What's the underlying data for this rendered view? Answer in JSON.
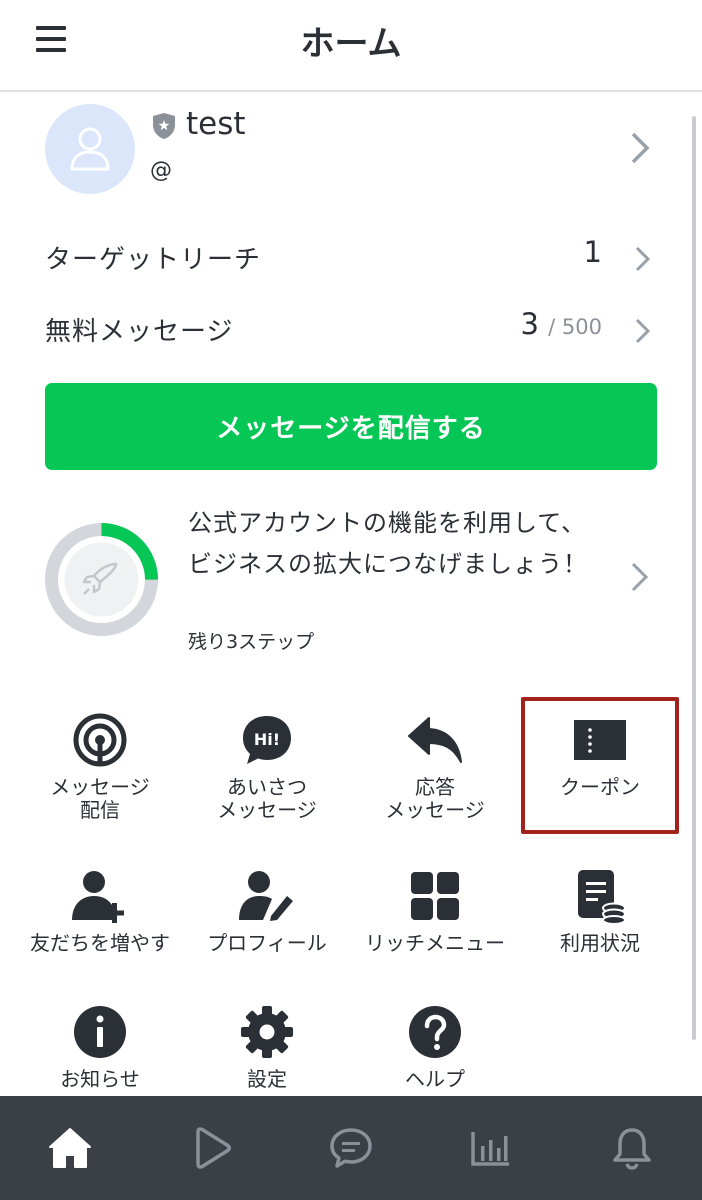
{
  "header": {
    "title": "ホーム"
  },
  "profile": {
    "name": "test",
    "id_prefix": "@"
  },
  "stats": {
    "target_reach": {
      "label": "ターゲットリーチ",
      "value": "1"
    },
    "free_messages": {
      "label": "無料メッセージ",
      "value": "3",
      "limit": "/ 500"
    }
  },
  "primary_action": {
    "label": "メッセージを配信する"
  },
  "onboarding": {
    "text": "公式アカウントの機能を利用して、ビジネスの拡大につなげましょう！",
    "steps": "残り3ステップ",
    "progress": 0.25
  },
  "features": [
    {
      "label": "メッセージ\n配信",
      "icon": "broadcast-icon"
    },
    {
      "label": "あいさつ\nメッセージ",
      "icon": "greeting-icon"
    },
    {
      "label": "応答\nメッセージ",
      "icon": "reply-icon"
    },
    {
      "label": "クーポン",
      "icon": "coupon-icon"
    },
    {
      "label": "友だちを増やす",
      "icon": "add-friend-icon"
    },
    {
      "label": "プロフィール",
      "icon": "profile-edit-icon"
    },
    {
      "label": "リッチメニュー",
      "icon": "rich-menu-icon"
    },
    {
      "label": "利用状況",
      "icon": "usage-icon"
    },
    {
      "label": "お知らせ",
      "icon": "info-icon"
    },
    {
      "label": "設定",
      "icon": "settings-icon"
    },
    {
      "label": "ヘルプ",
      "icon": "help-icon"
    }
  ],
  "bottom_nav": [
    "home-icon",
    "voom-icon",
    "chat-icon",
    "analytics-icon",
    "notifications-icon"
  ],
  "colors": {
    "accent": "#06c755",
    "text": "#2b2f36",
    "nav_bg": "#3b4047",
    "highlight": "#a3221c",
    "avatar_bg": "#dbe6fb"
  }
}
